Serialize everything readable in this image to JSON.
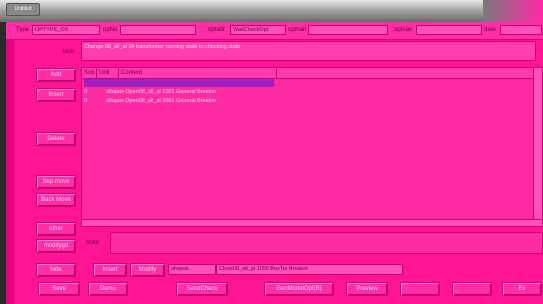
{
  "window": {
    "tab_label": "Untitled"
  },
  "filters": {
    "type_label": "Type",
    "type_value": "OPTYPE_OX",
    "opno_label": "opNo",
    "opno_value": "",
    "optattr_label": "optattr",
    "optattr_value": "WaitCheckOpt",
    "opman_label": "opman",
    "opman_value": "",
    "opman2_label": "opman",
    "opman2_value": "",
    "date_label": "date",
    "date_value": ""
  },
  "task": {
    "label": "task",
    "text": "Change 08_all_al 1# transformer running state to checking state"
  },
  "sidebar_buttons": [
    "Add",
    "Insert",
    "Delete",
    "Sep move",
    "Back Move",
    "other",
    "modifygd",
    "hide"
  ],
  "table": {
    "columns": [
      "Sub",
      "Unit",
      "Content"
    ],
    "rows": [
      {
        "sub": "0",
        "unit": "",
        "content": "altapas Open08_all_al 1001 General Breaker"
      },
      {
        "sub": "0",
        "unit": "",
        "content": "altapas Open08_all_al 3501 General Breaker"
      }
    ]
  },
  "state": {
    "label": "state",
    "value": ""
  },
  "editor": {
    "insert_label": "Insert",
    "modify_label": "Modify",
    "station_value": "altapas",
    "content_value": "Close08_all_al 1050 BusTie Breaker"
  },
  "bottom_buttons": {
    "save": "Save",
    "demo": "Demo",
    "send_check": "SendCheck",
    "gen_model": "GenModelOpt(B)",
    "preview": "Preview",
    "btn6": "",
    "btn7": "",
    "btn8": "Ex"
  }
}
